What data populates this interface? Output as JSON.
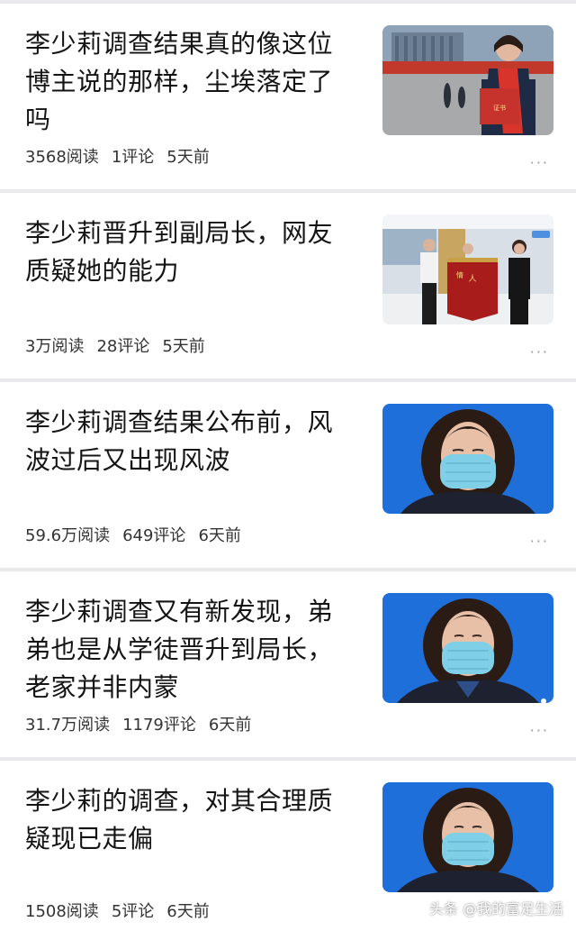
{
  "articles": [
    {
      "title": "李少莉调查结果真的像这位博主说的那样，尘埃落定了吗",
      "reads": "3568阅读",
      "comments": "1评论",
      "time": "5天前",
      "more": "···",
      "thumb_icon": "ceremony-photo-icon"
    },
    {
      "title": "李少莉晋升到副局长，网友质疑她的能力",
      "reads": "3万阅读",
      "comments": "28评论",
      "time": "5天前",
      "more": "···",
      "thumb_icon": "banner-award-photo-icon"
    },
    {
      "title": "李少莉调查结果公布前，风波过后又出现风波",
      "reads": "59.6万阅读",
      "comments": "649评论",
      "time": "6天前",
      "more": "···",
      "thumb_icon": "masked-woman-photo-icon"
    },
    {
      "title": "李少莉调查又有新发现，弟弟也是从学徒晋升到局长，老家并非内蒙",
      "reads": "31.7万阅读",
      "comments": "1179评论",
      "time": "6天前",
      "more": "···",
      "thumb_icon": "masked-woman-photo-icon"
    },
    {
      "title": "李少莉的调查，对其合理质疑现已走偏",
      "reads": "1508阅读",
      "comments": "5评论",
      "time": "6天前",
      "more": "···",
      "thumb_icon": "masked-woman-photo-icon"
    }
  ],
  "watermark": "头条 @我的富足生活",
  "colors": {
    "background": "#e9e9ec",
    "card": "#ffffff",
    "thumb_blue": "#1e6fd9"
  }
}
